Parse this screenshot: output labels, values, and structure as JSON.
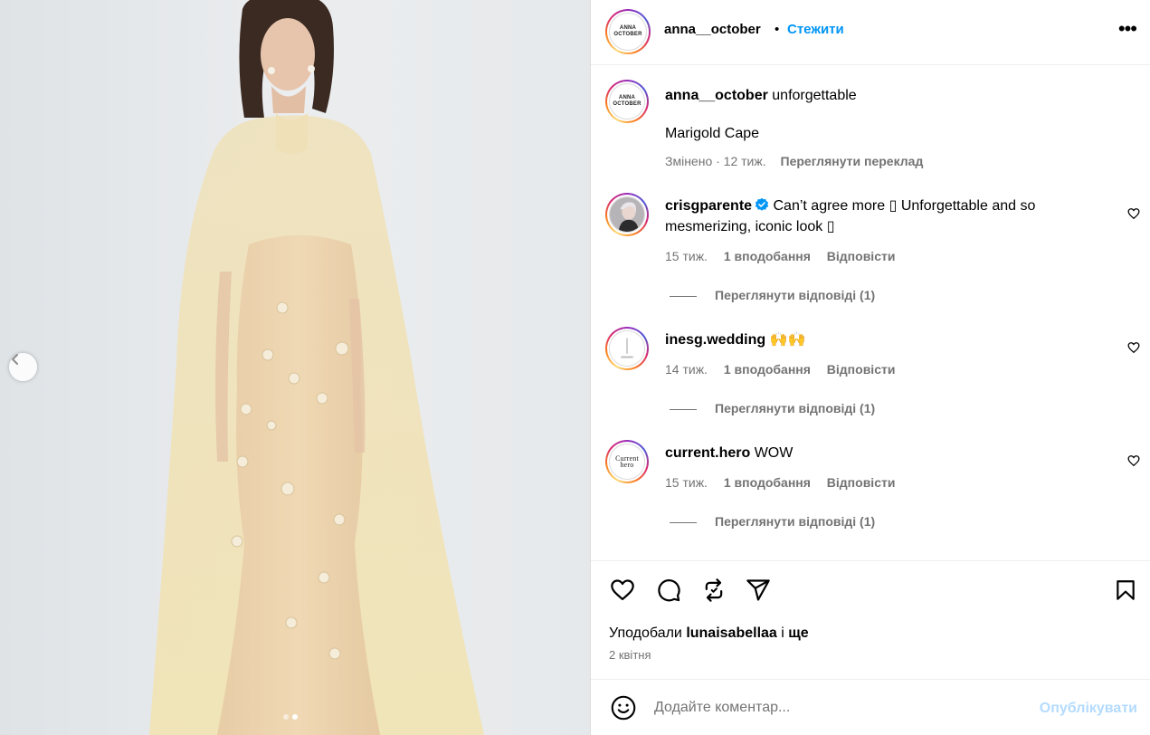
{
  "photo": {
    "carousel_dots": 2,
    "active_dot": 2
  },
  "post": {
    "author": "anna__october",
    "avatar_text_line1": "ANNA",
    "avatar_text_line2": "OCTOBER",
    "separator": "•",
    "follow_label": "Стежити",
    "more_label": "•••"
  },
  "caption": {
    "author": "anna__october",
    "text": "unforgettable",
    "line2": "Marigold Cape",
    "edited": "Змінено · 12 тиж.",
    "translate": "Переглянути переклад"
  },
  "comments": [
    {
      "username": "crisgparente",
      "verified": true,
      "text": "Can’t agree more ▯ Unforgettable and so mesmerizing, iconic look ▯",
      "time": "15 тиж.",
      "likes": "1 вподобання",
      "reply": "Відповісти",
      "view_replies": "Переглянути відповіді (1)"
    },
    {
      "username": "inesg.wedding",
      "verified": false,
      "text": "🙌🙌",
      "time": "14 тиж.",
      "likes": "1 вподобання",
      "reply": "Відповісти",
      "view_replies": "Переглянути відповіді (1)"
    },
    {
      "username": "current.hero",
      "verified": false,
      "text": "WOW",
      "avatar_text": "Current hero",
      "time": "15 тиж.",
      "likes": "1 вподобання",
      "reply": "Відповісти",
      "view_replies": "Переглянути відповіді (1)"
    }
  ],
  "likes_bar": {
    "prefix": "Уподобали",
    "user": "lunaisabellaa",
    "middle": "і",
    "suffix": "ще",
    "date": "2 квітня"
  },
  "compose": {
    "placeholder": "Додайте коментар...",
    "publish_label": "Опублікувати"
  },
  "colors": {
    "accent": "#0095f6",
    "publish_disabled": "#b3dbff",
    "muted_text": "#737373"
  },
  "icons": [
    "chevron-left-icon",
    "more-icon",
    "heart-icon",
    "comment-icon",
    "repost-icon",
    "share-icon",
    "bookmark-icon",
    "emoji-icon",
    "verified-icon"
  ]
}
